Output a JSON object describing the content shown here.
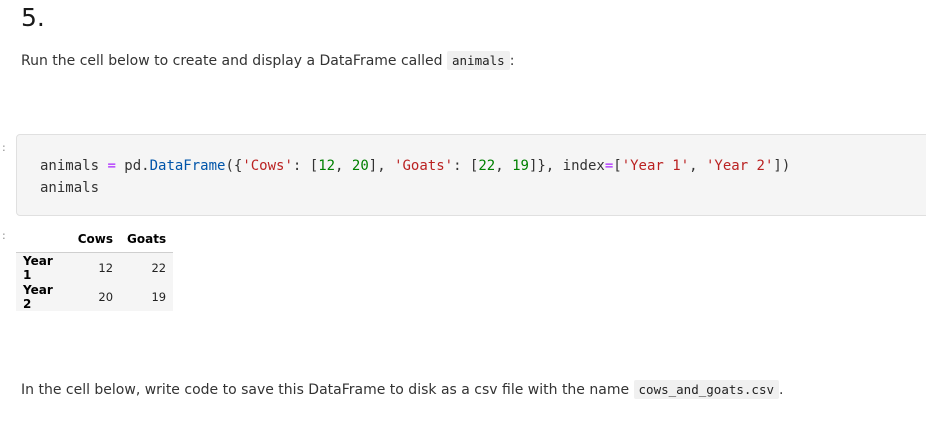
{
  "heading": "5.",
  "intro": {
    "text_before": "Run the cell below to create and display a DataFrame called ",
    "code": "animals",
    "text_after": ":"
  },
  "prompt_markers": [
    ":",
    ":"
  ],
  "code_cell": {
    "line1": {
      "t1": "animals ",
      "t2": "=",
      "t3": " pd.",
      "t4": "DataFrame",
      "t5": "({",
      "t6": "'Cows'",
      "t7": ": [",
      "t8": "12",
      "t9": ", ",
      "t10": "20",
      "t11": "], ",
      "t12": "'Goats'",
      "t13": ": [",
      "t14": "22",
      "t15": ", ",
      "t16": "19",
      "t17": "]}, index",
      "t18": "=",
      "t19": "[",
      "t20": "'Year 1'",
      "t21": ", ",
      "t22": "'Year 2'",
      "t23": "])"
    },
    "line2": "animals"
  },
  "dataframe": {
    "columns": [
      "Cows",
      "Goats"
    ],
    "rows": [
      {
        "index": "Year 1",
        "values": [
          "12",
          "22"
        ]
      },
      {
        "index": "Year 2",
        "values": [
          "20",
          "19"
        ]
      }
    ]
  },
  "instruction": {
    "text_before": "In the cell below, write code to save this DataFrame to disk as a csv file with the name ",
    "code": "cows_and_goats.csv",
    "text_after": "."
  }
}
